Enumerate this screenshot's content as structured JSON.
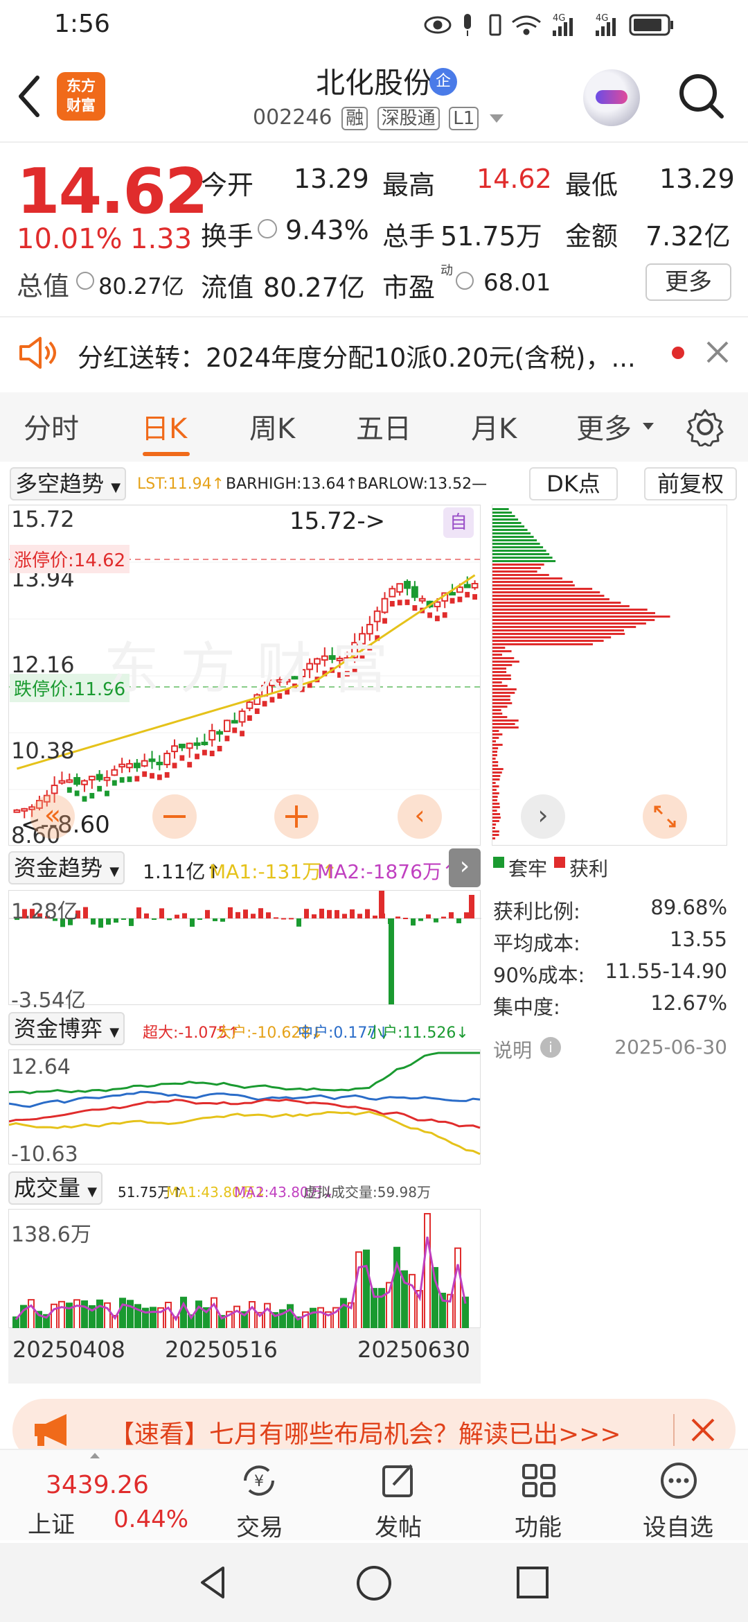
{
  "status_bar": {
    "time": "1:56",
    "signal_label_1": "4G",
    "signal_label_2": "4G"
  },
  "header": {
    "logo_line1": "东方",
    "logo_line2": "财富",
    "stock_name": "北化股份",
    "badge": "企",
    "stock_code": "002246",
    "tags": [
      "融",
      "深股通",
      "L1"
    ]
  },
  "quote": {
    "price": "14.62",
    "change_pct": "10.01%",
    "change_amt": "1.33",
    "fields": [
      {
        "label": "今开",
        "value": "13.29",
        "color": "#222222"
      },
      {
        "label": "最高",
        "value": "14.62",
        "color": "#e02c2c"
      },
      {
        "label": "最低",
        "value": "13.29",
        "color": "#222222"
      },
      {
        "label": "换手",
        "value": "9.43%",
        "color": "#222222"
      },
      {
        "label": "总手",
        "value": "51.75万",
        "color": "#222222"
      },
      {
        "label": "金额",
        "value": "7.32亿",
        "color": "#222222"
      },
      {
        "label": "流值",
        "value": "80.27亿",
        "color": "#222222"
      },
      {
        "label": "市盈",
        "value": "68.01",
        "color": "#222222"
      }
    ],
    "mktcap_label": "总值",
    "mktcap_value": "80.27亿",
    "pe_superscript": "动",
    "more_button": "更多"
  },
  "announcement": {
    "text": "分红送转：2024年度分配10派0.20元(含税)，..."
  },
  "tabs": [
    "分时",
    "日K",
    "周K",
    "五日",
    "月K",
    "更多"
  ],
  "active_tab": "日K",
  "kline_toolbar": {
    "indicator": "多空趋势",
    "lst": "LST:11.94↑",
    "barhigh": "BARHIGH:13.64↑",
    "barlow": "BARLOW:13.52—",
    "dk_button": "DK点",
    "adjust_button": "前复权"
  },
  "kline": {
    "y_labels": [
      "15.72",
      "13.94",
      "12.16",
      "10.38",
      "8.60"
    ],
    "limit_up_label": "涨停价:14.62",
    "limit_down_label": "跌停价:11.96",
    "max_annotation": "15.72->",
    "min_annotation": "<--8.60",
    "auto_tag": "自",
    "watermark": "东方财富",
    "colors": {
      "up": "#e02c2c",
      "down": "#1a9a30",
      "ma": "#e5c21a"
    }
  },
  "chip_distribution": {
    "legend_trapped": "套牢",
    "legend_profit": "获利",
    "rows": [
      {
        "label": "获利比例:",
        "value": "89.68%"
      },
      {
        "label": "平均成本:",
        "value": "13.55"
      },
      {
        "label": "90%成本:",
        "value": "11.55-14.90"
      },
      {
        "label": "集中度:",
        "value": "12.67%"
      }
    ],
    "note_label": "说明",
    "date": "2025-06-30"
  },
  "fund_trend": {
    "title": "资金趋势",
    "value": "1.11亿↑",
    "ma1": "MA1:-131万↑",
    "ma2": "MA2:-1876万↑",
    "y_top": "1.28亿",
    "y_bottom": "-3.54亿"
  },
  "fund_game": {
    "title": "资金博弈",
    "super": "超大:-1.075↑",
    "big": "大户:-10.628↓",
    "mid": "中户:0.177↓",
    "small": "小户:11.526↓",
    "y_top": "12.64",
    "y_bottom": "-10.63"
  },
  "volume": {
    "title": "成交量",
    "total": "51.75万↑",
    "ma1": "MA1:43.80万↓",
    "ma2": "MA2:43.80万↓",
    "virtual": "虚拟成交量:59.98万",
    "y_top": "138.6万",
    "dates": [
      "20250408",
      "20250516",
      "20250630"
    ]
  },
  "ad_banner": {
    "text": "【速看】七月有哪些布局机会？解读已出>>>"
  },
  "bottom_nav": {
    "index_value": "3439.26",
    "index_name": "上证",
    "index_pct": "0.44%",
    "items": [
      "交易",
      "发帖",
      "功能",
      "设自选"
    ]
  }
}
